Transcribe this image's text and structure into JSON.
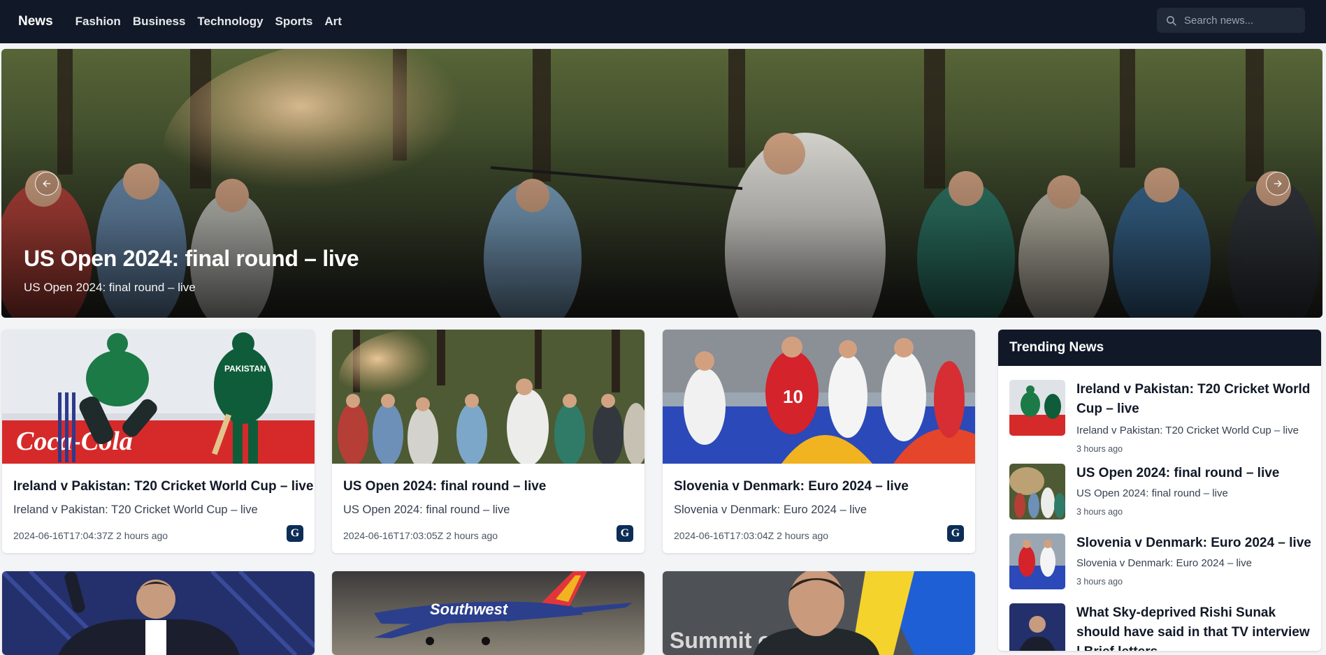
{
  "nav": {
    "brand": "News",
    "links": [
      "Fashion",
      "Business",
      "Technology",
      "Sports",
      "Art"
    ],
    "search_placeholder": "Search news..."
  },
  "hero": {
    "title": "US Open 2024: final round – live",
    "subtitle": "US Open 2024: final round – live",
    "prev_icon": "arrow-left-icon",
    "next_icon": "arrow-right-icon"
  },
  "cards": [
    {
      "title": "Ireland v Pakistan: T20 Cricket World Cup – live",
      "summary": "Ireland v Pakistan: T20 Cricket World Cup – live",
      "timestamp": "2024-06-16T17:04:37Z",
      "ago": "2 hours ago",
      "source_icon": "guardian-logo-icon"
    },
    {
      "title": "US Open 2024: final round – live",
      "summary": "US Open 2024: final round – live",
      "timestamp": "2024-06-16T17:03:05Z",
      "ago": "2 hours ago",
      "source_icon": "guardian-logo-icon"
    },
    {
      "title": "Slovenia v Denmark: Euro 2024 – live",
      "summary": "Slovenia v Denmark: Euro 2024 – live",
      "timestamp": "2024-06-16T17:03:04Z",
      "ago": "2 hours ago",
      "source_icon": "guardian-logo-icon"
    },
    {
      "title": "",
      "summary": "",
      "timestamp": "",
      "ago": ""
    },
    {
      "title": "",
      "summary": "",
      "timestamp": "",
      "ago": ""
    },
    {
      "title": "",
      "summary": "",
      "timestamp": "",
      "ago": ""
    }
  ],
  "card_images_visible_text": {
    "cricket_shirt": "PAKISTAN",
    "cricket_board": "Coca-Cola",
    "plane_livery": "Southwest",
    "summit_banner": "Summit on"
  },
  "trending": {
    "header": "Trending News",
    "items": [
      {
        "title": "Ireland v Pakistan: T20 Cricket World Cup – live",
        "summary": "Ireland v Pakistan: T20 Cricket World Cup – live",
        "time": "3 hours ago"
      },
      {
        "title": "US Open 2024: final round – live",
        "summary": "US Open 2024: final round – live",
        "time": "3 hours ago"
      },
      {
        "title": "Slovenia v Denmark: Euro 2024 – live",
        "summary": "Slovenia v Denmark: Euro 2024 – live",
        "time": "3 hours ago"
      },
      {
        "title": "What Sky-deprived Rishi Sunak should have said in that TV interview | Brief letters",
        "summary": "",
        "time": ""
      }
    ]
  },
  "colors": {
    "nav_bg": "#111827",
    "search_bg": "#1f2937",
    "source_badge": "#0c2d57"
  }
}
